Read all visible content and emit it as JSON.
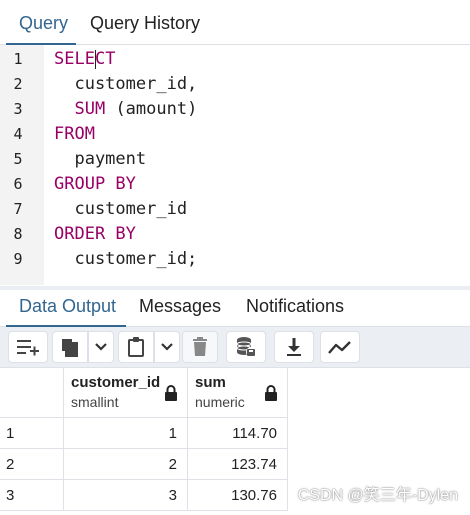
{
  "editor_tabs": [
    {
      "label": "Query",
      "active": true
    },
    {
      "label": "Query History",
      "active": false
    }
  ],
  "editor": {
    "lines": [
      {
        "num": "1",
        "tokens": [
          {
            "t": "SELE",
            "c": "kw"
          },
          {
            "t": "CT",
            "c": "kw"
          }
        ]
      },
      {
        "num": "2",
        "tokens": [
          {
            "t": "  customer_id,",
            "c": ""
          }
        ]
      },
      {
        "num": "3",
        "tokens": [
          {
            "t": "  ",
            "c": ""
          },
          {
            "t": "SUM",
            "c": "fn"
          },
          {
            "t": " (amount)",
            "c": ""
          }
        ]
      },
      {
        "num": "4",
        "tokens": [
          {
            "t": "FROM",
            "c": "kw"
          }
        ]
      },
      {
        "num": "5",
        "tokens": [
          {
            "t": "  payment",
            "c": ""
          }
        ]
      },
      {
        "num": "6",
        "tokens": [
          {
            "t": "GROUP BY",
            "c": "kw"
          }
        ]
      },
      {
        "num": "7",
        "tokens": [
          {
            "t": "  customer_id",
            "c": ""
          }
        ]
      },
      {
        "num": "8",
        "tokens": [
          {
            "t": "ORDER BY",
            "c": "kw"
          }
        ]
      },
      {
        "num": "9",
        "tokens": [
          {
            "t": "  customer_id;",
            "c": ""
          }
        ]
      }
    ]
  },
  "output_tabs": [
    {
      "label": "Data Output",
      "active": true
    },
    {
      "label": "Messages",
      "active": false
    },
    {
      "label": "Notifications",
      "active": false
    }
  ],
  "toolbar": {
    "buttons": [
      "add-row-icon",
      "copy-icon",
      "chevron-down-icon",
      "paste-icon",
      "chevron-down-icon",
      "delete-icon",
      "save-data-icon",
      "download-icon",
      "graph-icon"
    ]
  },
  "grid": {
    "columns": [
      {
        "name": "customer_id",
        "type": "smallint"
      },
      {
        "name": "sum",
        "type": "numeric"
      }
    ],
    "rows": [
      {
        "num": "1",
        "customer_id": "1",
        "sum": "114.70"
      },
      {
        "num": "2",
        "customer_id": "2",
        "sum": "123.74"
      },
      {
        "num": "3",
        "customer_id": "3",
        "sum": "130.76"
      }
    ]
  },
  "watermark": "CSDN @笑三年-Dylen"
}
